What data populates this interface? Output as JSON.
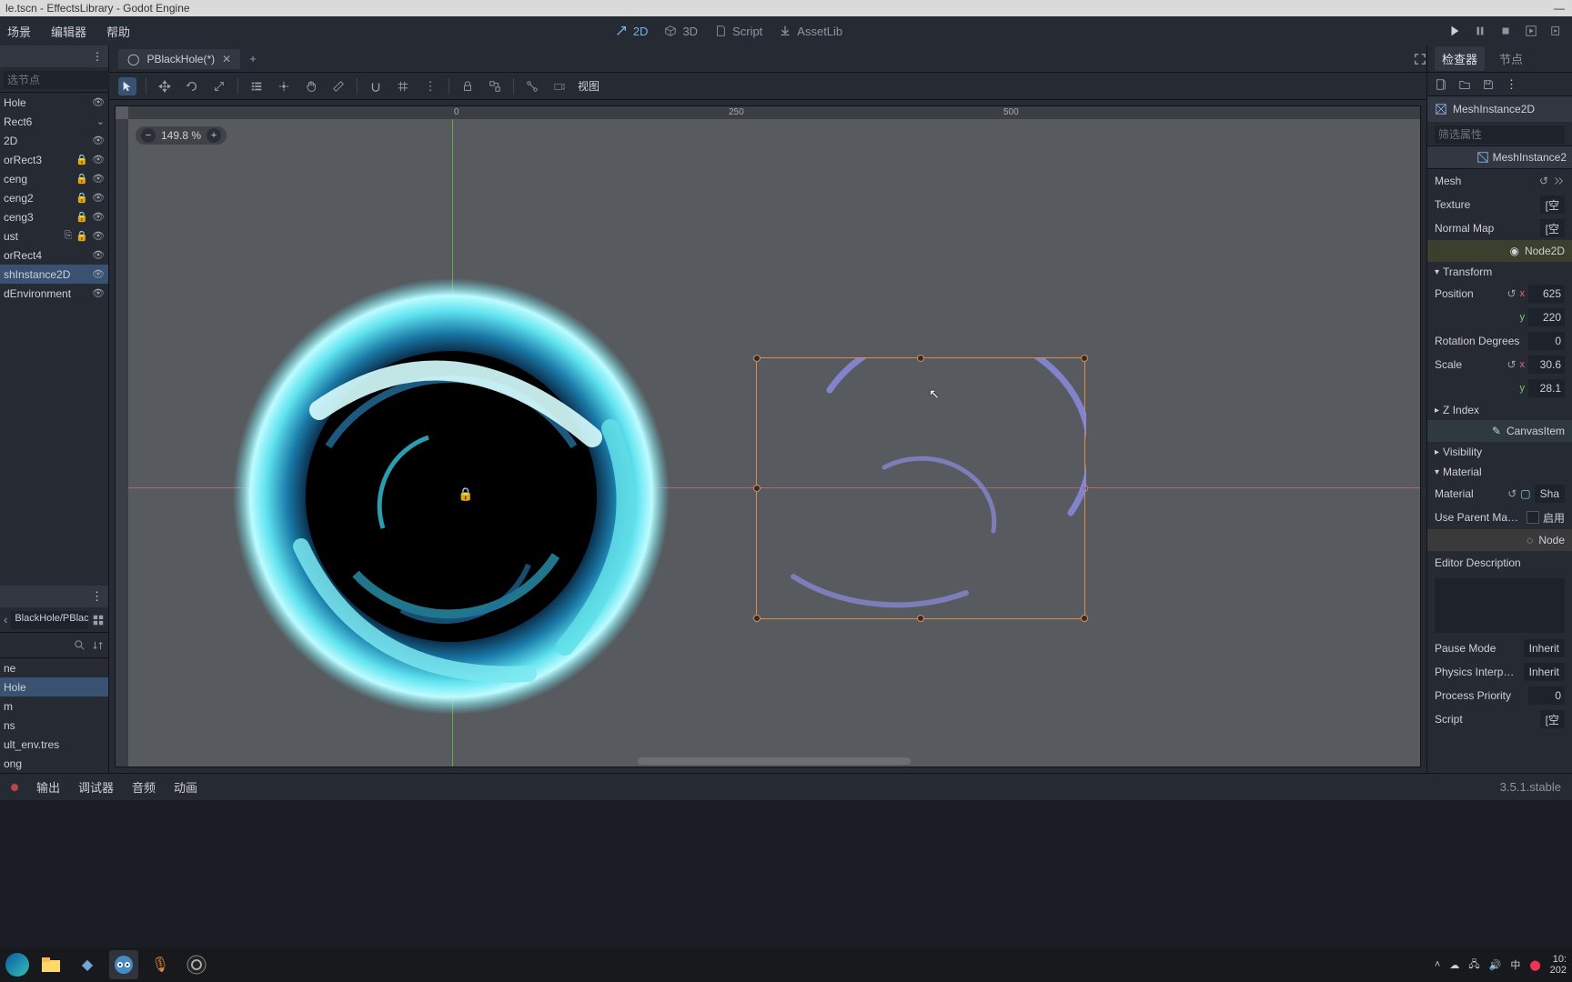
{
  "window_title": "le.tscn - EffectsLibrary - Godot Engine",
  "menu": {
    "scene": "场景",
    "editor": "编辑器",
    "help": "帮助"
  },
  "workspaces": {
    "d2": "2D",
    "d3": "3D",
    "script": "Script",
    "assetlib": "AssetLib"
  },
  "scene_tab": {
    "name": "PBlackHole(*)"
  },
  "scene_tab_add": "+",
  "canvas": {
    "zoom_text": "149.8 %",
    "ruler_marks": [
      "0",
      "250",
      "500"
    ],
    "view_label": "视图"
  },
  "scene_tree": {
    "filter_ph": "选节点",
    "nodes": [
      {
        "name": "Hole",
        "lock": false,
        "vis": true
      },
      {
        "name": "Rect6",
        "lock": false,
        "vis": true,
        "script": true
      },
      {
        "name": "2D",
        "lock": false,
        "vis": true
      },
      {
        "name": "orRect3",
        "lock": true,
        "vis": true
      },
      {
        "name": "ceng",
        "lock": true,
        "vis": true
      },
      {
        "name": "ceng2",
        "lock": true,
        "vis": true
      },
      {
        "name": "ceng3",
        "lock": true,
        "vis": true
      },
      {
        "name": "ust",
        "lock": true,
        "vis": true,
        "extra": true
      },
      {
        "name": "orRect4",
        "lock": false,
        "vis": true
      },
      {
        "name": "shInstance2D",
        "lock": false,
        "vis": true,
        "selected": true
      },
      {
        "name": "dEnvironment",
        "lock": false,
        "vis": false
      }
    ]
  },
  "fs": {
    "path": "BlackHole/PBlack",
    "files": [
      "ne",
      "Hole",
      "m",
      "ns",
      "ult_env.tres",
      "ong"
    ]
  },
  "inspector": {
    "tab_inspector": "检查器",
    "tab_node": "节点",
    "object_type": "MeshInstance2D",
    "filter_ph": "筛选属性",
    "crumb": "MeshInstance2",
    "props": {
      "mesh_label": "Mesh",
      "texture_label": "Texture",
      "texture_val": "[空",
      "normal_label": "Normal Map",
      "normal_val": "[空",
      "section_node2d": "Node2D",
      "transform_label": "Transform",
      "position_label": "Position",
      "pos_x": "625",
      "pos_y": "220",
      "rotation_label": "Rotation Degrees",
      "rotation_val": "0",
      "scale_label": "Scale",
      "scale_x": "30.6",
      "scale_y": "28.1",
      "zindex_label": "Z Index",
      "section_canvasitem": "CanvasItem",
      "visibility_label": "Visibility",
      "material_section": "Material",
      "material_label": "Material",
      "material_val": "Sha",
      "use_parent_label": "Use Parent Materi",
      "use_parent_val": "启用",
      "section_node": "Node",
      "editor_desc_label": "Editor Description",
      "pause_mode_label": "Pause Mode",
      "pause_mode_val": "Inherit",
      "physics_label": "Physics Interpolati",
      "physics_val": "Inherit",
      "priority_label": "Process Priority",
      "priority_val": "0",
      "script_label": "Script",
      "script_val": "[空"
    }
  },
  "bottom": {
    "output": "输出",
    "debugger": "调试器",
    "audio": "音频",
    "anim": "动画",
    "version": "3.5.1.stable"
  },
  "taskbar": {
    "ime": "中",
    "clock_top": "10:",
    "clock_bottom": "202"
  }
}
